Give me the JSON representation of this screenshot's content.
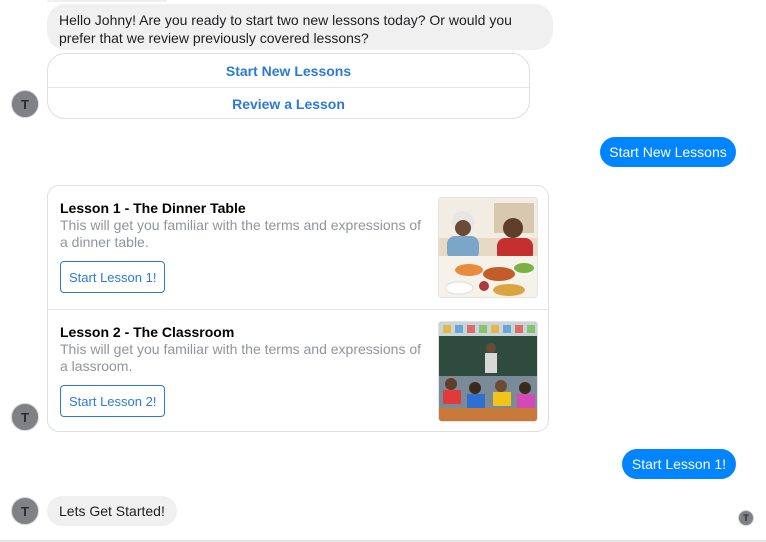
{
  "messages": {
    "greeting": "Hello Johny! Are you ready to start two new lessons today? Or would you prefer that we review previously covered lessons?",
    "quick_replies": [
      "Start New Lessons",
      "Review a Lesson"
    ],
    "user_reply_1": "Start New Lessons",
    "lessons": [
      {
        "title": "Lesson 1 - The Dinner Table",
        "description": "This will get you familiar with the terms and expressions of a dinner table.",
        "button": "Start Lesson 1!"
      },
      {
        "title": "Lesson 2 - The Classroom",
        "description": "This will get you familiar with the terms and expressions of a lassroom.",
        "button": "Start Lesson 2!"
      }
    ],
    "user_reply_2": "Start Lesson 1!",
    "final": "Lets Get Started!"
  },
  "avatar": {
    "initial": "T"
  },
  "colors": {
    "outgoing": "#0084ff",
    "incoming": "#f0f0f0",
    "link": "#2b7bd6"
  }
}
